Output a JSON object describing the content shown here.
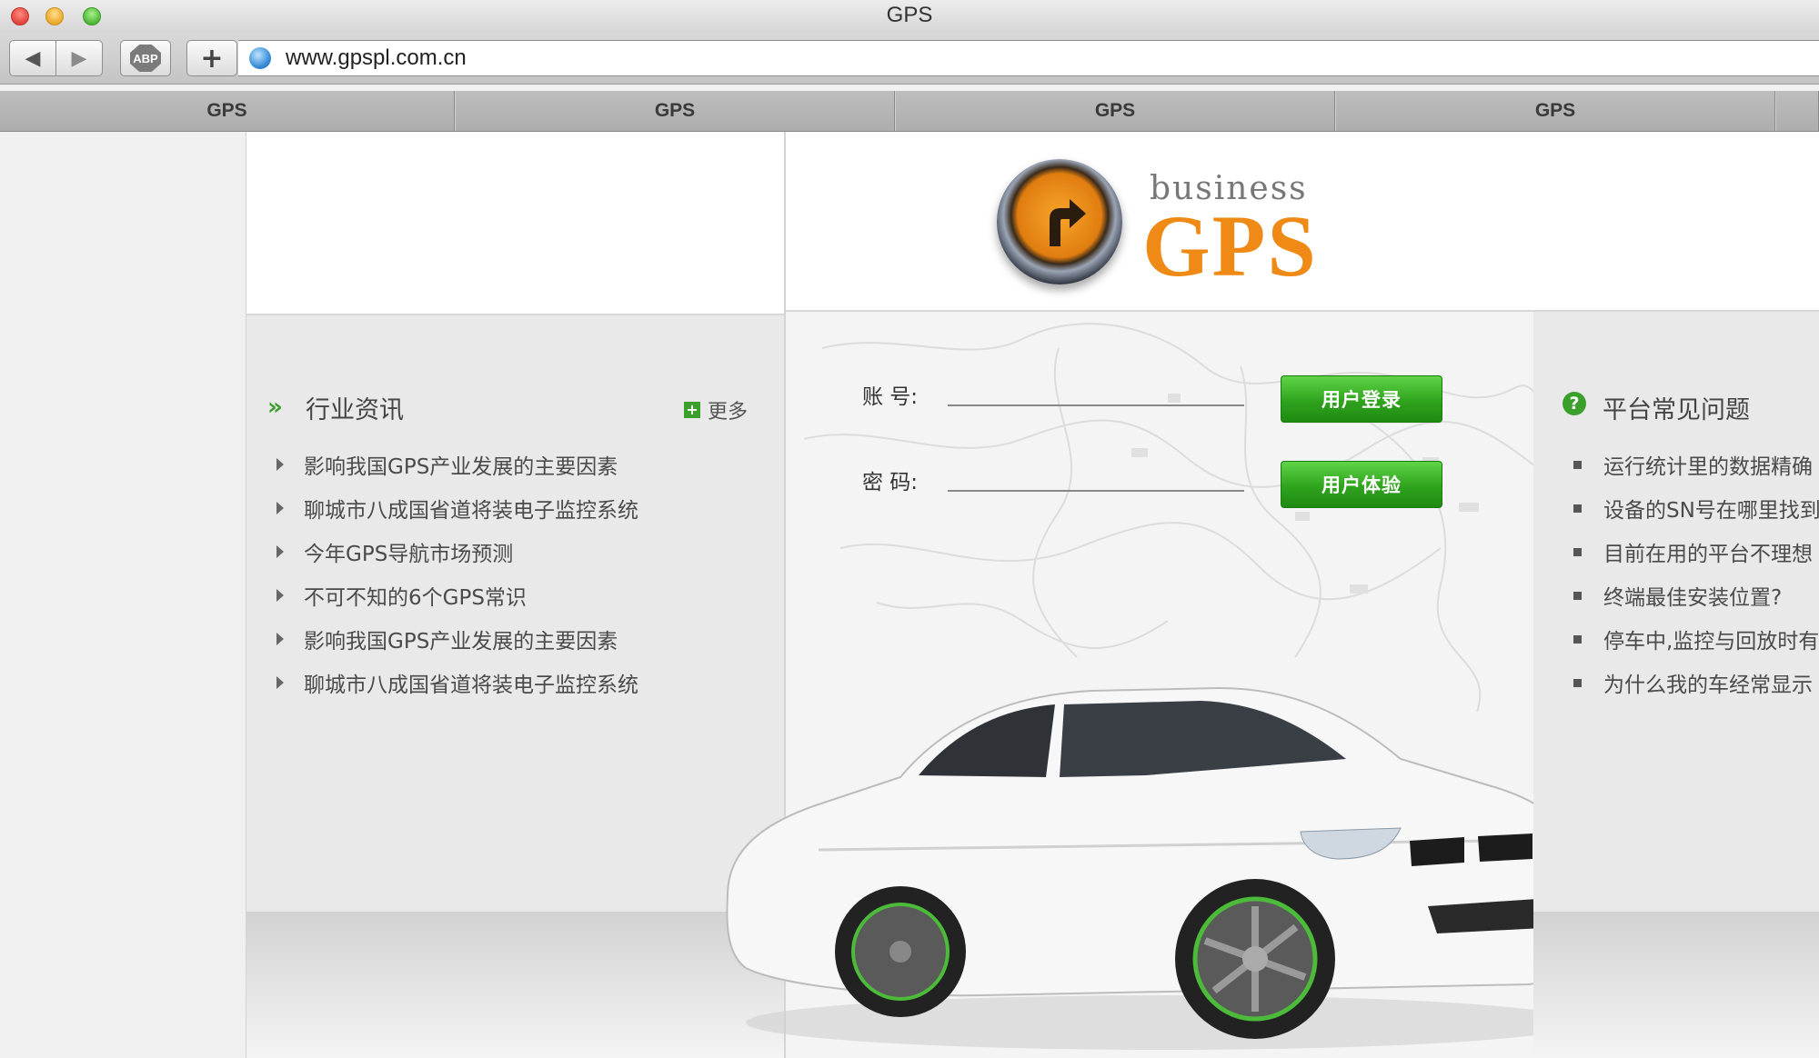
{
  "window": {
    "title": "GPS"
  },
  "toolbar": {
    "abp_label": "ABP",
    "newtab_label": "+",
    "back_symbol": "◀",
    "forward_symbol": "▶"
  },
  "address_bar": {
    "url": "www.gpspl.com.cn"
  },
  "tabs": [
    {
      "label": "GPS"
    },
    {
      "label": "GPS"
    },
    {
      "label": "GPS"
    },
    {
      "label": "GPS"
    }
  ],
  "news": {
    "title": "行业资讯",
    "more_label": "更多",
    "items": [
      "影响我国GPS产业发展的主要因素",
      "聊城市八成国省道将装电子监控系统",
      "今年GPS导航市场预测",
      "不可不知的6个GPS常识",
      "影响我国GPS产业发展的主要因素",
      "聊城市八成国省道将装电子监控系统"
    ]
  },
  "logo": {
    "small_text": "business",
    "big_text": "GPS"
  },
  "login": {
    "account_label": "账 号:",
    "password_label": "密 码:",
    "login_button": "用户登录",
    "trial_button": "用户体验"
  },
  "faq": {
    "title": "平台常见问题",
    "items": [
      "运行统计里的数据精确",
      "设备的SN号在哪里找到",
      "目前在用的平台不理想",
      "终端最佳安装位置?",
      "停车中,监控与回放时有",
      "为什么我的车经常显示"
    ]
  },
  "colors": {
    "accent_green": "#3aa02b",
    "logo_orange": "#f08a16"
  },
  "icons": [
    "close-dot",
    "minimize-dot",
    "zoom-dot",
    "back-arrow",
    "forward-arrow",
    "adblock",
    "plus",
    "globe",
    "double-chevron",
    "plus-square",
    "triangle-bullet",
    "question-circle",
    "square-bullet"
  ]
}
